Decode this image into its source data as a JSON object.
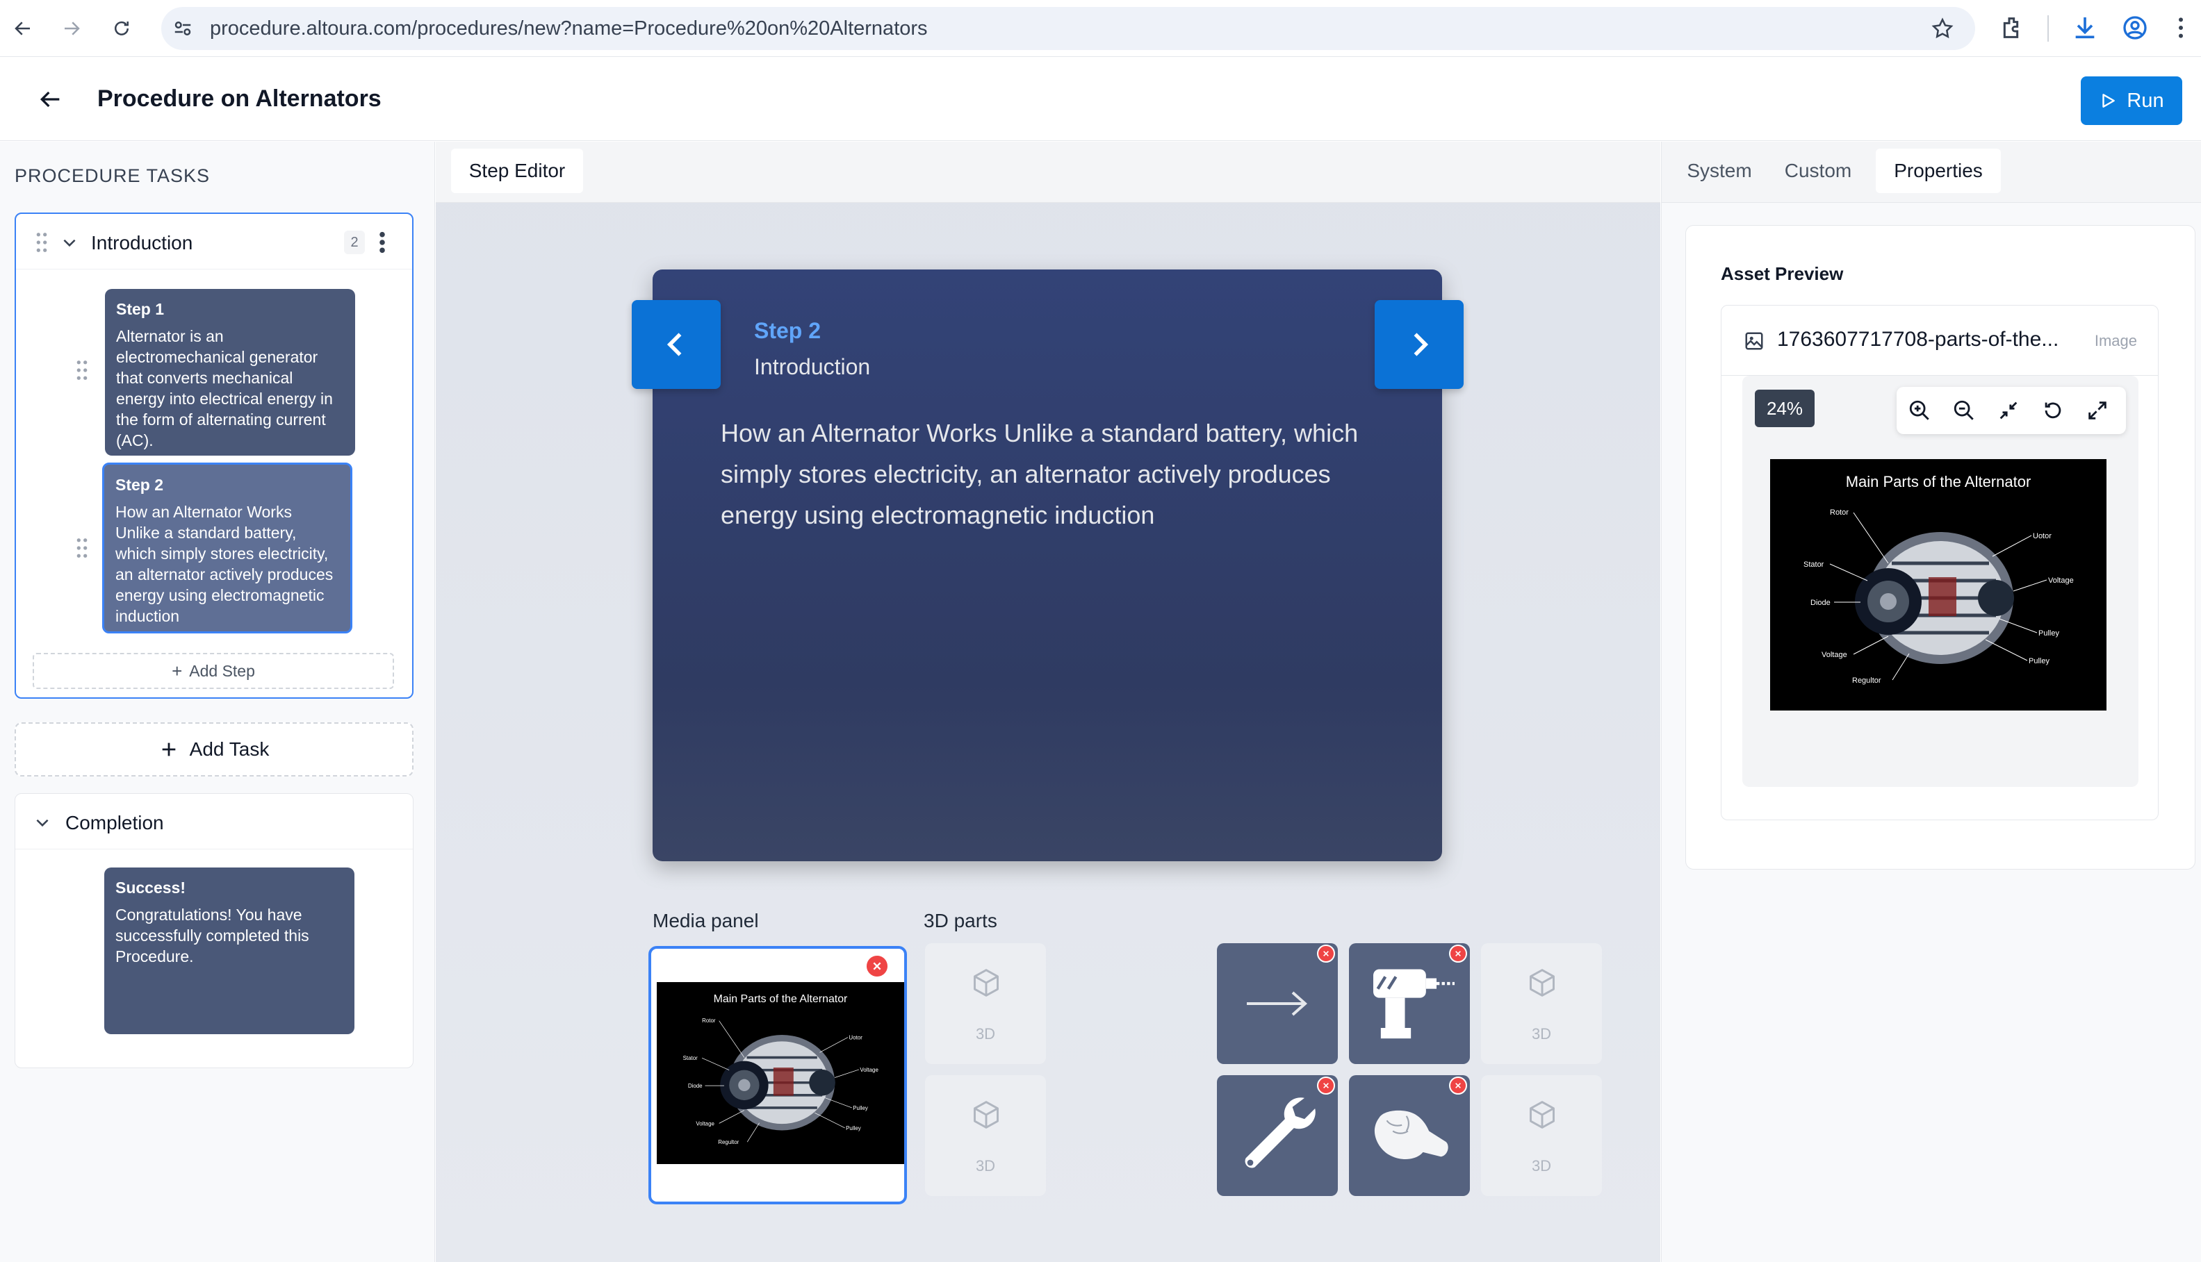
{
  "browser": {
    "url": "procedure.altoura.com/procedures/new?name=Procedure%20on%20Alternators"
  },
  "header": {
    "title": "Procedure on Alternators",
    "run_label": "Run"
  },
  "left": {
    "section_heading": "PROCEDURE TASKS",
    "tasks": [
      {
        "title": "Introduction",
        "count": "2",
        "steps": [
          {
            "title": "Step 1",
            "body": "Alternator is an electromechanical generator that converts mechanical energy into electrical energy in the form of alternating current (AC)."
          },
          {
            "title": "Step 2",
            "body": "How an Alternator Works Unlike a standard battery, which simply stores electricity, an alternator actively produces energy using electromagnetic induction"
          }
        ],
        "add_step_label": "Add Step"
      },
      {
        "title": "Completion",
        "steps": [
          {
            "title": "Success!",
            "body": "Congratulations! You have successfully completed this Procedure."
          }
        ]
      }
    ],
    "add_task_label": "Add Task"
  },
  "center": {
    "tab_label": "Step Editor",
    "step_number": "Step 2",
    "step_task": "Introduction",
    "step_body": "How an Alternator Works Unlike a standard battery, which simply stores electricity, an alternator actively produces energy using electromagnetic induction",
    "media_panel_label": "Media panel",
    "parts_label": "3D parts",
    "empty_part_label": "3D",
    "parts": [
      {
        "slot": 1,
        "kind": "empty",
        "icon": "cube-icon"
      },
      {
        "slot": 2,
        "kind": "filled",
        "icon": "arrow-right-icon"
      },
      {
        "slot": 3,
        "kind": "filled",
        "icon": "drill-icon"
      },
      {
        "slot": 4,
        "kind": "empty",
        "icon": "cube-icon"
      },
      {
        "slot": 5,
        "kind": "empty",
        "icon": "cube-icon"
      },
      {
        "slot": 6,
        "kind": "filled",
        "icon": "wrench-icon"
      },
      {
        "slot": 7,
        "kind": "filled",
        "icon": "fist-icon"
      },
      {
        "slot": 8,
        "kind": "empty",
        "icon": "cube-icon"
      }
    ]
  },
  "diagram": {
    "title": "Main Parts of the Alternator",
    "labels": [
      "Rotor",
      "Stator",
      "Diode",
      "Voltage",
      "Regultor",
      "Uotor",
      "Voltage",
      "Pulley",
      "Pulley"
    ]
  },
  "right": {
    "tabs": [
      "System",
      "Custom",
      "Properties"
    ],
    "active_tab": "Properties",
    "asset_preview_title": "Asset Preview",
    "file_name": "1763607717708-parts-of-the...",
    "file_type": "Image",
    "zoom": "24%"
  },
  "colors": {
    "accent": "#0b7fe0",
    "selection": "#3b82f6",
    "step_panel": "#334377",
    "remove": "#ef4444"
  }
}
